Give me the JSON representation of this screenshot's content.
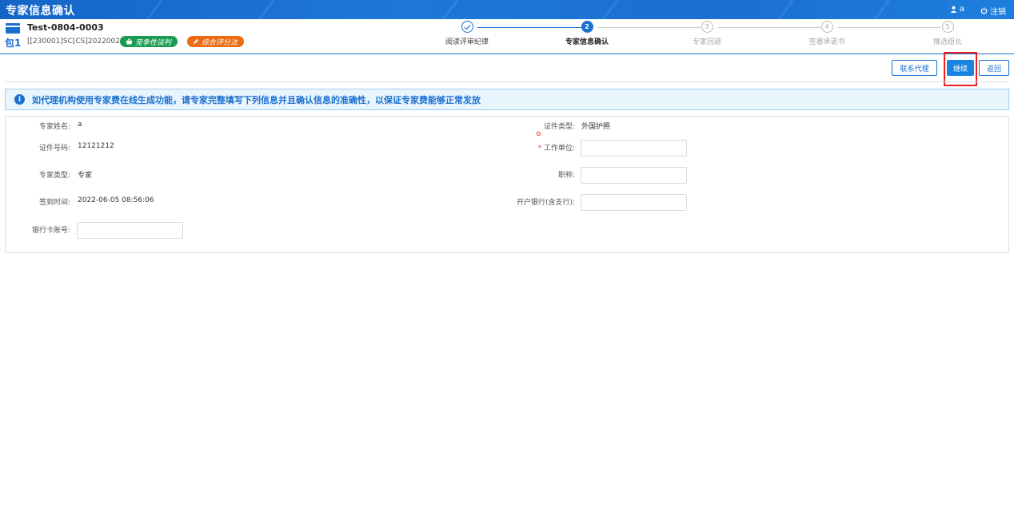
{
  "header": {
    "title": "专家信息确认",
    "user_name": "a",
    "logout_label": "注销"
  },
  "project": {
    "package_label": "包1",
    "name": "Test-0804-0003",
    "code": "[[230001]SC[CS]20220027 ]",
    "badges": [
      {
        "label": "竞争性谈判",
        "color": "#1a9b52"
      },
      {
        "label": "综合评分法",
        "color": "#ef6b12"
      }
    ]
  },
  "steps": [
    {
      "number": "",
      "label": "阅读评审纪律",
      "state": "done"
    },
    {
      "number": "2",
      "label": "专家信息确认",
      "state": "active"
    },
    {
      "number": "3",
      "label": "专家回避",
      "state": "todo"
    },
    {
      "number": "4",
      "label": "签署承诺书",
      "state": "todo"
    },
    {
      "number": "5",
      "label": "推选组长",
      "state": "todo"
    }
  ],
  "actions": {
    "contact_agent": "联系代理",
    "continue": "继续",
    "back": "返回"
  },
  "notice": "如代理机构使用专家费在线生成功能，请专家完整填写下列信息并且确认信息的准确性，以保证专家费能够正常发放",
  "form": {
    "expert_name_label": "专家姓名:",
    "expert_name_value": "a",
    "id_type_label": "证件类型:",
    "id_type_value": "外国护照",
    "id_number_label": "证件号码:",
    "id_number_value": "12121212",
    "work_unit_label": "工作单位:",
    "work_unit_value": "",
    "expert_type_label": "专家类型:",
    "expert_type_value": "专家",
    "title_label": "职称:",
    "title_value": "",
    "checkin_time_label": "签到时间:",
    "checkin_time_value": "2022-06-05 08:56:06",
    "bank_label": "开户银行(含支行):",
    "bank_value": "",
    "card_label": "银行卡账号:",
    "card_value": ""
  },
  "colors": {
    "primary": "#1a6fd0",
    "highlight": "#e82020"
  }
}
